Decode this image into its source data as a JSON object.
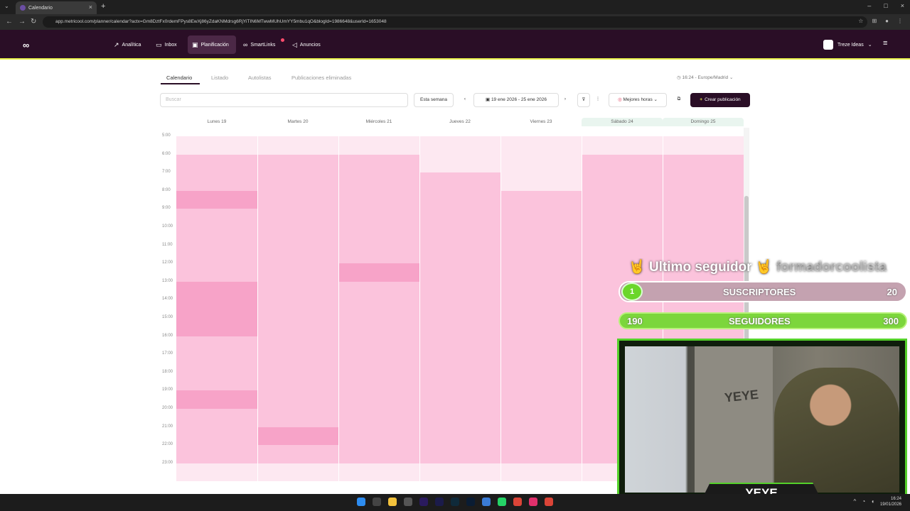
{
  "browser": {
    "tab_title": "Calendario",
    "url": "app.metricool.com/planner/calendar?actx=Gm8DztFx0rdemFPys8EwXj86yZdaKNMdrsg6RjYiTIN6MTwwMUhUmYY5mbu1qO&blogId=1986648&userId=1653048"
  },
  "header": {
    "logo": "∞",
    "nav": [
      {
        "label": "Analítica",
        "icon": "chart-icon"
      },
      {
        "label": "Inbox",
        "icon": "inbox-icon"
      },
      {
        "label": "Planificación",
        "icon": "calendar-icon"
      },
      {
        "label": "SmartLinks",
        "icon": "link-icon"
      },
      {
        "label": "Anuncios",
        "icon": "megaphone-icon"
      }
    ],
    "brand": "Treze Ideas"
  },
  "tabs": [
    "Calendario",
    "Listado",
    "Autolistas",
    "Publicaciones eliminadas"
  ],
  "timezone": "16:24 - Europe/Madrid",
  "toolbar": {
    "search_placeholder": "Buscar",
    "this_week": "Esta semana",
    "date_range": "19 ene 2026 - 25 ene 2026",
    "best_hours": "Mejores horas",
    "create": "Crear publicación"
  },
  "days": [
    "Lunes 19",
    "Martes 20",
    "Miércoles 21",
    "Jueves 22",
    "Viernes 23",
    "Sábado 24",
    "Domingo 25"
  ],
  "hours": [
    "5:00",
    "6:00",
    "7:00",
    "8:00",
    "9:00",
    "10:00",
    "11:00",
    "12:00",
    "13:00",
    "14:00",
    "15:00",
    "16:00",
    "17:00",
    "18:00",
    "19:00",
    "20:00",
    "21:00",
    "22:00",
    "23:00"
  ],
  "heat_colors": {
    "low": "#fde8f1",
    "mid": "#fbc3dc",
    "high": "#f7a3c8"
  },
  "overlay": {
    "last_follower": "Ultimo seguidor",
    "follower_name": "formadorcoolista",
    "subs_label": "SUSCRIPTORES",
    "subs_current": "1",
    "subs_goal": "20",
    "followers_label": "SEGUIDORES",
    "followers_current": "190",
    "followers_goal": "300",
    "cam_name": "YEYE",
    "wall_text": "YEYE"
  },
  "clock": {
    "time": "16:24",
    "date": "19/01/2026"
  }
}
